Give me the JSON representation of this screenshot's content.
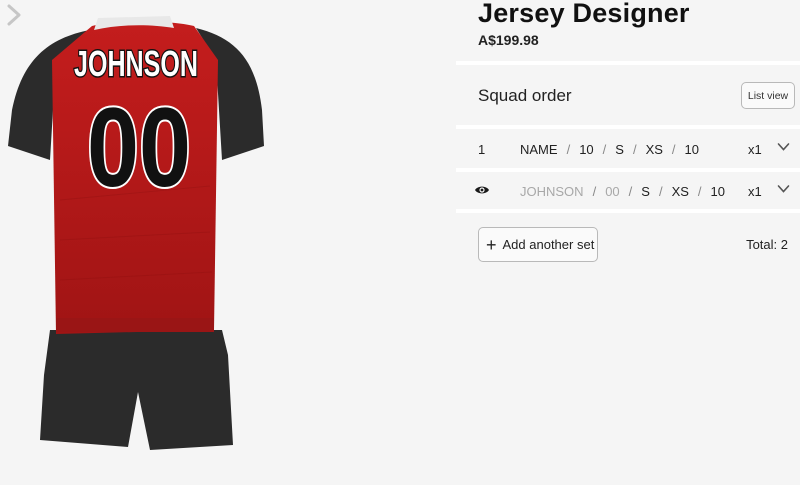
{
  "product": {
    "title": "Jersey Designer",
    "price": "A$199.98"
  },
  "jersey": {
    "player_name": "JOHNSON",
    "player_number": "00",
    "colors": {
      "body": "#b01818",
      "sleeves": "#2b2b2b",
      "shorts": "#2b2b2b",
      "collar": "#e8e8e8"
    }
  },
  "squad": {
    "title": "Squad order",
    "list_view_label": "List view",
    "rows": [
      {
        "index": "1",
        "name": "NAME",
        "number": "10",
        "size1": "S",
        "size2": "XS",
        "extra": "10",
        "qty": "x1",
        "icon": "chevron-down-icon"
      },
      {
        "icon_lead": "eye-icon",
        "name": "JOHNSON",
        "number": "00",
        "size1": "S",
        "size2": "XS",
        "extra": "10",
        "qty": "x1",
        "icon": "chevron-down-icon"
      }
    ],
    "separator": "/",
    "add_label": "Add another set",
    "total_label": "Total: 2"
  },
  "nav": {
    "next_icon": "chevron-right-icon"
  }
}
